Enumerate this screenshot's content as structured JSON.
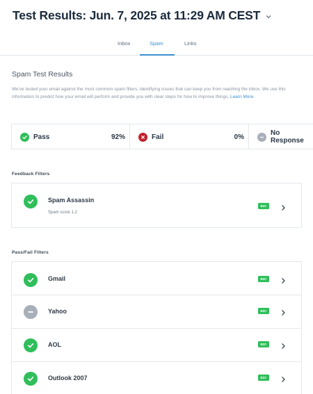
{
  "header": {
    "title": "Test Results: Jun. 7, 2025 at 11:29 AM CEST",
    "tabs": [
      {
        "label": "Inbox",
        "active": false
      },
      {
        "label": "Spam",
        "active": true
      },
      {
        "label": "Links",
        "active": false
      }
    ]
  },
  "spam_section": {
    "title": "Spam Test Results",
    "description": "We've tested your email against the most common spam filters, identifying issues that can keep you from reaching the inbox. We use this information to predict how your email will perform and provide you with clear steps for how to improve things.",
    "learn_more": "Learn More."
  },
  "summary": {
    "pass": {
      "label": "Pass",
      "value": "92%",
      "icon": "check-icon"
    },
    "fail": {
      "label": "Fail",
      "value": "0%",
      "icon": "x-icon"
    },
    "no_response": {
      "label": "No Response",
      "icon": "minus-icon"
    }
  },
  "feedback_filters": {
    "label": "Feedback Filters",
    "items": [
      {
        "name": "Spam Assassin",
        "sub": "Spam score 1.2",
        "badge": "B2C",
        "status": "pass"
      }
    ]
  },
  "pass_fail_filters": {
    "label": "Pass/Fail Filters",
    "items": [
      {
        "name": "Gmail",
        "badge": "B2C",
        "status": "pass"
      },
      {
        "name": "Yahoo",
        "badge": "B2C",
        "status": "neutral"
      },
      {
        "name": "AOL",
        "badge": "B2C",
        "status": "pass"
      },
      {
        "name": "Outlook 2007",
        "badge": "B2C",
        "status": "pass"
      }
    ]
  },
  "colors": {
    "accent": "#3a8fd0",
    "pass": "#2fbe5a",
    "fail": "#c0212e",
    "neutral": "#a7afb8"
  }
}
